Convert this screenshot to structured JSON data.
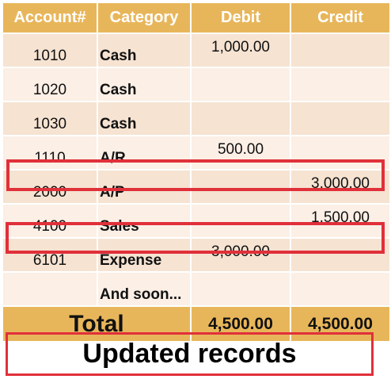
{
  "table": {
    "headers": {
      "account": "Account#",
      "category": "Category",
      "debit": "Debit",
      "credit": "Credit"
    },
    "rows": [
      {
        "account": "1010",
        "category": "Cash",
        "debit": "1,000.00",
        "credit": "",
        "credit_shaded": true
      },
      {
        "account": "1020",
        "category": "Cash",
        "debit": "",
        "credit": "",
        "credit_shaded": true
      },
      {
        "account": "1030",
        "category": "Cash",
        "debit": "",
        "credit": "",
        "credit_shaded": true
      },
      {
        "account": "1110",
        "category": "A/R",
        "debit": "500.00",
        "credit": "",
        "credit_shaded": true
      },
      {
        "account": "2000",
        "category": "A/P",
        "debit": "",
        "credit": "3,000.00",
        "debit_shaded": true,
        "highlighted": true
      },
      {
        "account": "4100",
        "category": "Sales",
        "debit": "",
        "credit": "1,500.00",
        "debit_shaded": true
      },
      {
        "account": "6101",
        "category": "Expense",
        "debit": "3,000.00",
        "credit": "",
        "credit_shaded": true,
        "highlighted": true
      },
      {
        "account": "",
        "category": "And soon...",
        "debit": "",
        "credit": ""
      }
    ],
    "totals": {
      "label": "Total",
      "debit": "4,500.00",
      "credit": "4,500.00"
    }
  },
  "caption": {
    "label": "Updated records"
  },
  "colors": {
    "header_bg": "#e8b65a",
    "band_a": "#f6e3d2",
    "band_b": "#fbefe6",
    "shaded_cell": "#7f7f7f",
    "highlight_outline": "#e0303a"
  }
}
